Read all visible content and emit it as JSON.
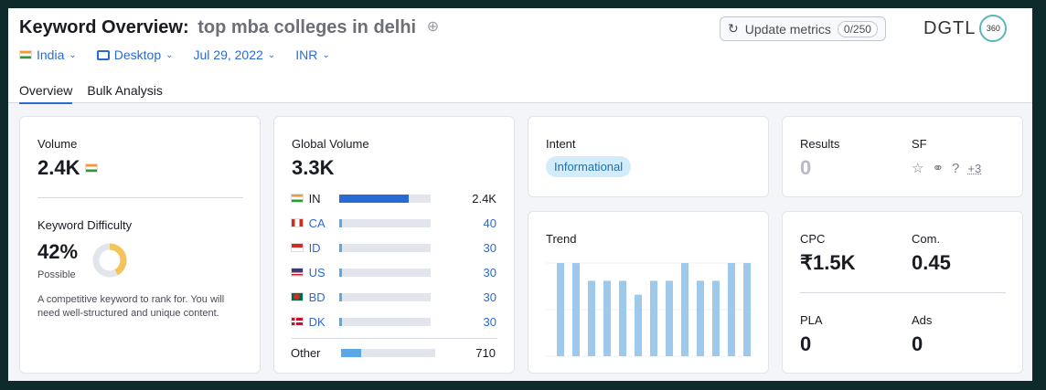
{
  "header": {
    "title_prefix": "Keyword Overview:",
    "keyword": "top mba colleges in delhi",
    "filters": [
      "India",
      "Desktop",
      "Jul 29, 2022",
      "INR"
    ],
    "tabs": [
      "Overview",
      "Bulk Analysis"
    ],
    "update_label": "Update metrics",
    "update_count": "0/250",
    "logo_text": "DGTL",
    "logo_ring": "360"
  },
  "volume": {
    "label": "Volume",
    "value": "2.4K",
    "kd_label": "Keyword Difficulty",
    "kd_value": "42%",
    "kd_level": "Possible",
    "kd_percent": 42,
    "kd_desc": "A competitive keyword to rank for. You will need well-structured and unique content."
  },
  "global_volume": {
    "label": "Global Volume",
    "value": "3.3K",
    "rows": [
      {
        "code": "IN",
        "value": "2.4K",
        "fraction": 0.73,
        "flag": "in"
      },
      {
        "code": "CA",
        "value": "40",
        "fraction": 0.02,
        "flag": "ca"
      },
      {
        "code": "ID",
        "value": "30",
        "fraction": 0.02,
        "flag": "id"
      },
      {
        "code": "US",
        "value": "30",
        "fraction": 0.02,
        "flag": "us"
      },
      {
        "code": "BD",
        "value": "30",
        "fraction": 0.02,
        "flag": "bd"
      },
      {
        "code": "DK",
        "value": "30",
        "fraction": 0.02,
        "flag": "dk"
      }
    ],
    "other_label": "Other",
    "other_value": "710",
    "other_fraction": 0.21
  },
  "intent": {
    "label": "Intent",
    "value": "Informational"
  },
  "trend": {
    "label": "Trend"
  },
  "chart_data": {
    "type": "bar",
    "categories": [
      "1",
      "2",
      "3",
      "4",
      "5",
      "6",
      "7",
      "8",
      "9",
      "10",
      "11",
      "12"
    ],
    "values": [
      1.0,
      1.0,
      0.81,
      0.81,
      0.81,
      0.66,
      0.81,
      0.81,
      1.0,
      0.81,
      0.81,
      1.0,
      1.0
    ],
    "title": "Trend",
    "ylim": [
      0,
      1
    ]
  },
  "results": {
    "label": "Results",
    "value": "0",
    "sf_label": "SF",
    "sf_more": "+3"
  },
  "cpc": {
    "cpc_label": "CPC",
    "cpc_value": "₹1.5K",
    "com_label": "Com.",
    "com_value": "0.45",
    "pla_label": "PLA",
    "pla_value": "0",
    "ads_label": "Ads",
    "ads_value": "0"
  },
  "colors": {
    "accent": "#2a6ad3",
    "trend_bar": "#9fc9ea",
    "kd_ring": "#f4c35a"
  }
}
